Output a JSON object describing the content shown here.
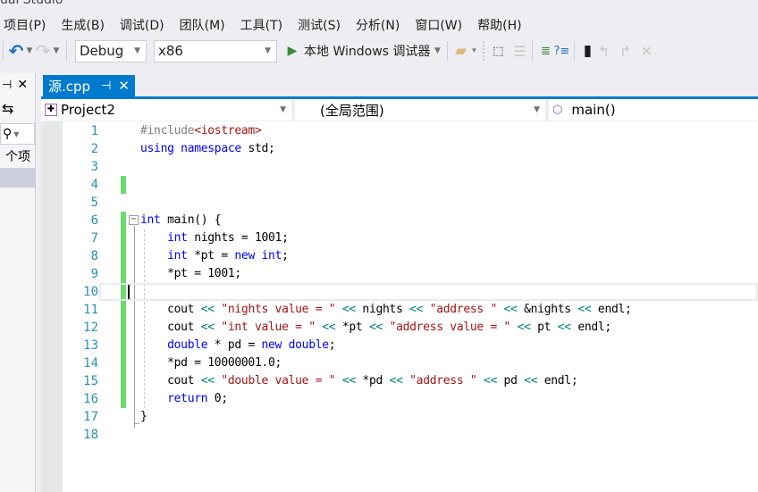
{
  "window": {
    "title": "ual Studio"
  },
  "menu": [
    "项目(P)",
    "生成(B)",
    "调试(D)",
    "团队(M)",
    "工具(T)",
    "测试(S)",
    "分析(N)",
    "窗口(W)",
    "帮助(H)"
  ],
  "toolbar": {
    "config": "Debug",
    "platform": "x86",
    "debugger": "本地 Windows 调试器",
    "icons": [
      "undo-icon",
      "redo-icon",
      "start-debug-icon",
      "find-in-files-icon",
      "select-item-icon",
      "unindent-icon",
      "comment-icon",
      "uncomment-icon",
      "bookmark-icon",
      "prev-bookmark-icon",
      "next-bookmark-icon",
      "clear-bookmarks-icon"
    ]
  },
  "left_panel": {
    "items_label": "个项"
  },
  "document_tab": {
    "name": "源.cpp"
  },
  "navbar": {
    "project": "Project2",
    "scope": "(全局范围)",
    "member": "main()"
  },
  "editor": {
    "caret_line": 10,
    "changed_lines": [
      4,
      6,
      7,
      8,
      9,
      10,
      11,
      12,
      13,
      14,
      15,
      16
    ],
    "lines": [
      [
        {
          "t": "pp",
          "v": "#include"
        },
        {
          "t": "inc",
          "v": "<iostream>"
        }
      ],
      [
        {
          "t": "kw",
          "v": "using"
        },
        {
          "t": "",
          "v": " "
        },
        {
          "t": "kw",
          "v": "namespace"
        },
        {
          "t": "",
          "v": " std;"
        }
      ],
      [],
      [],
      [],
      [
        {
          "t": "kw",
          "v": "int"
        },
        {
          "t": "",
          "v": " main() {"
        }
      ],
      [
        {
          "t": "",
          "v": "    "
        },
        {
          "t": "kw",
          "v": "int"
        },
        {
          "t": "",
          "v": " nights = 1001;"
        }
      ],
      [
        {
          "t": "",
          "v": "    "
        },
        {
          "t": "kw",
          "v": "int"
        },
        {
          "t": "",
          "v": " *pt = "
        },
        {
          "t": "kw",
          "v": "new"
        },
        {
          "t": "",
          "v": " "
        },
        {
          "t": "kw",
          "v": "int"
        },
        {
          "t": "",
          "v": ";"
        }
      ],
      [
        {
          "t": "",
          "v": "    *pt = 1001;"
        }
      ],
      [
        {
          "t": "",
          "v": "    "
        }
      ],
      [
        {
          "t": "",
          "v": "    cout "
        },
        {
          "t": "op",
          "v": "<<"
        },
        {
          "t": "",
          "v": " "
        },
        {
          "t": "str",
          "v": "\"nights value = \""
        },
        {
          "t": "",
          "v": " "
        },
        {
          "t": "op",
          "v": "<<"
        },
        {
          "t": "",
          "v": " nights "
        },
        {
          "t": "op",
          "v": "<<"
        },
        {
          "t": "",
          "v": " "
        },
        {
          "t": "str",
          "v": "\"address \""
        },
        {
          "t": "",
          "v": " "
        },
        {
          "t": "op",
          "v": "<<"
        },
        {
          "t": "",
          "v": " &nights "
        },
        {
          "t": "op",
          "v": "<<"
        },
        {
          "t": "",
          "v": " endl;"
        }
      ],
      [
        {
          "t": "",
          "v": "    cout "
        },
        {
          "t": "op",
          "v": "<<"
        },
        {
          "t": "",
          "v": " "
        },
        {
          "t": "str",
          "v": "\"int value = \""
        },
        {
          "t": "",
          "v": " "
        },
        {
          "t": "op",
          "v": "<<"
        },
        {
          "t": "",
          "v": " *pt "
        },
        {
          "t": "op",
          "v": "<<"
        },
        {
          "t": "",
          "v": " "
        },
        {
          "t": "str",
          "v": "\"address value = \""
        },
        {
          "t": "",
          "v": " "
        },
        {
          "t": "op",
          "v": "<<"
        },
        {
          "t": "",
          "v": " pt "
        },
        {
          "t": "op",
          "v": "<<"
        },
        {
          "t": "",
          "v": " endl;"
        }
      ],
      [
        {
          "t": "",
          "v": "    "
        },
        {
          "t": "kw",
          "v": "double"
        },
        {
          "t": "",
          "v": " * pd = "
        },
        {
          "t": "kw",
          "v": "new"
        },
        {
          "t": "",
          "v": " "
        },
        {
          "t": "kw",
          "v": "double"
        },
        {
          "t": "",
          "v": ";"
        }
      ],
      [
        {
          "t": "",
          "v": "    *pd = 10000001.0;"
        }
      ],
      [
        {
          "t": "",
          "v": "    cout "
        },
        {
          "t": "op",
          "v": "<<"
        },
        {
          "t": "",
          "v": " "
        },
        {
          "t": "str",
          "v": "\"double value = \""
        },
        {
          "t": "",
          "v": " "
        },
        {
          "t": "op",
          "v": "<<"
        },
        {
          "t": "",
          "v": " *pd "
        },
        {
          "t": "op",
          "v": "<<"
        },
        {
          "t": "",
          "v": " "
        },
        {
          "t": "str",
          "v": "\"address \""
        },
        {
          "t": "",
          "v": " "
        },
        {
          "t": "op",
          "v": "<<"
        },
        {
          "t": "",
          "v": " pd "
        },
        {
          "t": "op",
          "v": "<<"
        },
        {
          "t": "",
          "v": " endl;"
        }
      ],
      [
        {
          "t": "",
          "v": "    "
        },
        {
          "t": "kw",
          "v": "return"
        },
        {
          "t": "",
          "v": " 0;"
        }
      ],
      [
        {
          "t": "",
          "v": "}"
        }
      ],
      []
    ]
  }
}
